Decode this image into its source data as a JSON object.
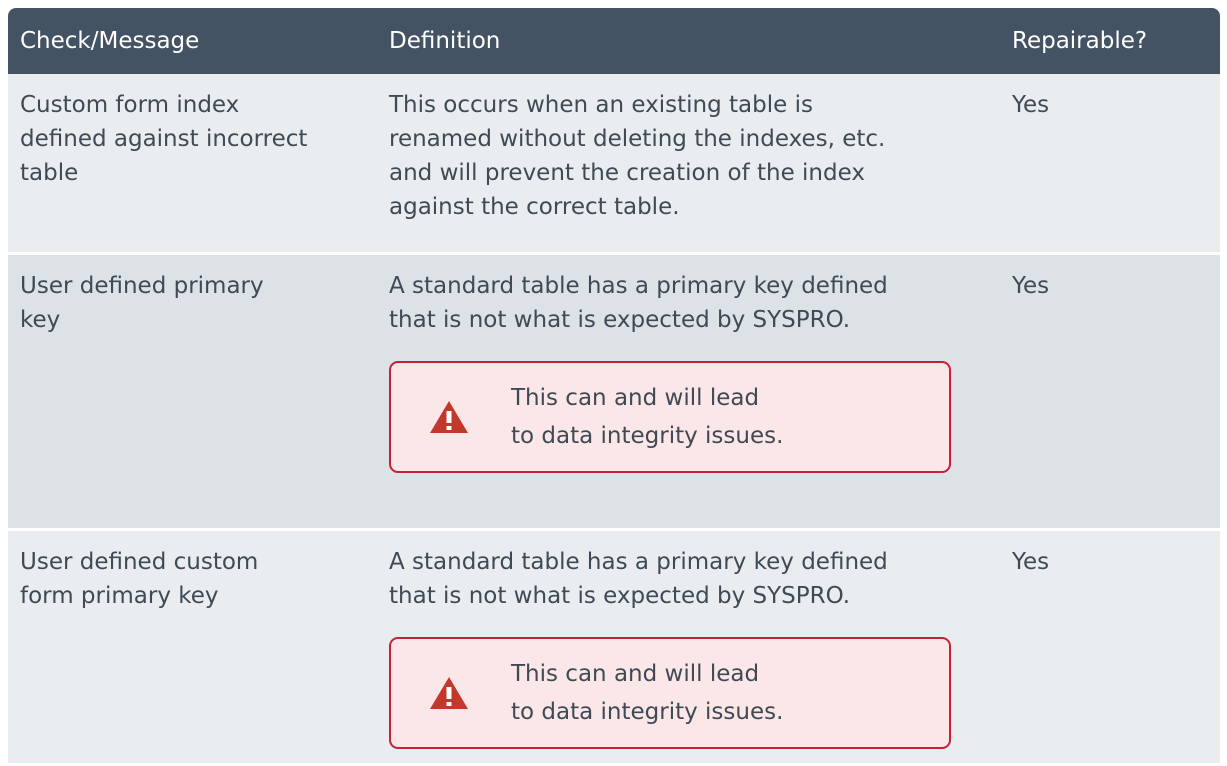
{
  "table": {
    "headers": [
      "Check/Message",
      "Definition",
      "Repairable?"
    ],
    "rows": [
      {
        "check": [
          "Custom form index",
          "defined against incorrect",
          "table"
        ],
        "definition": [
          "This occurs when an existing table is",
          "renamed without deleting the indexes, etc.",
          "and will prevent the creation of the index",
          "against the correct table."
        ],
        "repairable": "Yes"
      },
      {
        "check": [
          "User defined primary",
          "key"
        ],
        "definition": [
          "A standard table has a primary key defined",
          "that is not what is expected by SYSPRO."
        ],
        "warning": [
          "This can and will lead",
          "to data integrity issues."
        ],
        "repairable": "Yes"
      },
      {
        "check": [
          "User defined custom",
          "form primary key"
        ],
        "definition": [
          "A standard table has a primary key defined",
          "that is not what is expected by SYSPRO."
        ],
        "warning": [
          "This can and will lead",
          "to data integrity issues."
        ],
        "repairable": "Yes"
      }
    ]
  },
  "colors": {
    "header_bg": "#435363",
    "row_bg_light": "#e9edf0",
    "row_bg_dark": "#dde2e6",
    "warning_border": "#c8203b",
    "warning_bg": "#fbe7e7",
    "warning_icon": "#c0392b"
  },
  "icons": {
    "warning": "warning-triangle-icon"
  }
}
